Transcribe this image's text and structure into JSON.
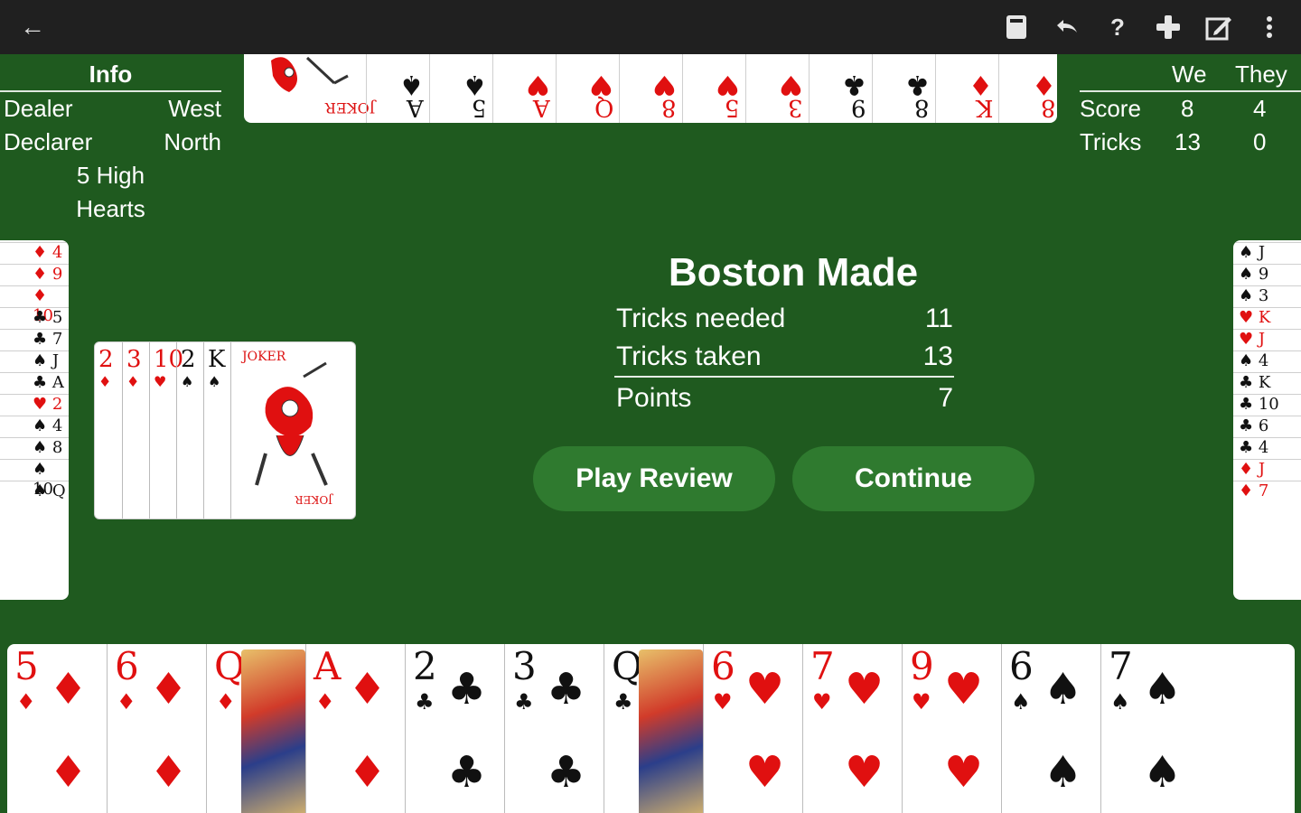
{
  "appbar": {
    "back_icon": "arrow-back-icon",
    "icons": [
      "cards-icon",
      "undo-icon",
      "help-icon",
      "new-game-icon",
      "edit-icon",
      "more-vert-icon"
    ]
  },
  "info": {
    "title": "Info",
    "rows": [
      {
        "label": "Dealer",
        "value": "West"
      },
      {
        "label": "Declarer",
        "value": "North"
      }
    ],
    "bid": "5 High",
    "trump": "Hearts"
  },
  "score": {
    "headers": {
      "we": "We",
      "they": "They"
    },
    "rows": [
      {
        "label": "Score",
        "we": "8",
        "they": "4"
      },
      {
        "label": "Tricks",
        "we": "13",
        "they": "0"
      }
    ]
  },
  "result": {
    "title": "Boston Made",
    "rows": [
      {
        "label": "Tricks needed",
        "value": "11"
      },
      {
        "label": "Tricks taken",
        "value": "13"
      },
      {
        "label": "Points",
        "value": "7"
      }
    ],
    "play_review": "Play Review",
    "continue": "Continue"
  },
  "north_hand": [
    {
      "rank": "A",
      "suit": "♠",
      "color": "black"
    },
    {
      "rank": "5",
      "suit": "♠",
      "color": "black"
    },
    {
      "rank": "A",
      "suit": "♥",
      "color": "red"
    },
    {
      "rank": "Q",
      "suit": "♥",
      "color": "red"
    },
    {
      "rank": "8",
      "suit": "♥",
      "color": "red"
    },
    {
      "rank": "5",
      "suit": "♥",
      "color": "red"
    },
    {
      "rank": "3",
      "suit": "♥",
      "color": "red"
    },
    {
      "rank": "9",
      "suit": "♣",
      "color": "black"
    },
    {
      "rank": "8",
      "suit": "♣",
      "color": "black"
    },
    {
      "rank": "K",
      "suit": "♦",
      "color": "red"
    },
    {
      "rank": "8",
      "suit": "♦",
      "color": "red"
    }
  ],
  "north_joker_text": "JOKER",
  "west_hand": [
    {
      "rank": "4",
      "suit": "♦",
      "color": "red"
    },
    {
      "rank": "9",
      "suit": "♦",
      "color": "red"
    },
    {
      "rank": "10",
      "suit": "♦",
      "color": "red"
    },
    {
      "rank": "5",
      "suit": "♣",
      "color": "black"
    },
    {
      "rank": "7",
      "suit": "♣",
      "color": "black"
    },
    {
      "rank": "J",
      "suit": "♠",
      "color": "black"
    },
    {
      "rank": "A",
      "suit": "♣",
      "color": "black"
    },
    {
      "rank": "2",
      "suit": "♥",
      "color": "red"
    },
    {
      "rank": "4",
      "suit": "♠",
      "color": "black"
    },
    {
      "rank": "8",
      "suit": "♠",
      "color": "black"
    },
    {
      "rank": "10",
      "suit": "♠",
      "color": "black"
    },
    {
      "rank": "Q",
      "suit": "♠",
      "color": "black"
    }
  ],
  "east_hand": [
    {
      "rank": "J",
      "suit": "♠",
      "color": "black"
    },
    {
      "rank": "9",
      "suit": "♠",
      "color": "black"
    },
    {
      "rank": "3",
      "suit": "♠",
      "color": "black"
    },
    {
      "rank": "K",
      "suit": "♥",
      "color": "red"
    },
    {
      "rank": "J",
      "suit": "♥",
      "color": "red"
    },
    {
      "rank": "4",
      "suit": "♠",
      "color": "black"
    },
    {
      "rank": "K",
      "suit": "♣",
      "color": "black"
    },
    {
      "rank": "10",
      "suit": "♣",
      "color": "black"
    },
    {
      "rank": "6",
      "suit": "♣",
      "color": "black"
    },
    {
      "rank": "4",
      "suit": "♣",
      "color": "black"
    },
    {
      "rank": "J",
      "suit": "♦",
      "color": "red"
    },
    {
      "rank": "7",
      "suit": "♦",
      "color": "red"
    }
  ],
  "kitty": [
    {
      "rank": "2",
      "suit": "♦",
      "color": "red"
    },
    {
      "rank": "3",
      "suit": "♦",
      "color": "red"
    },
    {
      "rank": "10",
      "suit": "♥",
      "color": "red"
    },
    {
      "rank": "2",
      "suit": "♠",
      "color": "black"
    },
    {
      "rank": "K",
      "suit": "♠",
      "color": "black"
    }
  ],
  "kitty_joker_text": "JOKER",
  "south_hand": [
    {
      "rank": "5",
      "suit": "♦",
      "color": "red"
    },
    {
      "rank": "6",
      "suit": "♦",
      "color": "red"
    },
    {
      "rank": "Q",
      "suit": "♦",
      "color": "red"
    },
    {
      "rank": "A",
      "suit": "♦",
      "color": "red"
    },
    {
      "rank": "2",
      "suit": "♣",
      "color": "black"
    },
    {
      "rank": "3",
      "suit": "♣",
      "color": "black"
    },
    {
      "rank": "Q",
      "suit": "♣",
      "color": "black"
    },
    {
      "rank": "6",
      "suit": "♥",
      "color": "red"
    },
    {
      "rank": "7",
      "suit": "♥",
      "color": "red"
    },
    {
      "rank": "9",
      "suit": "♥",
      "color": "red"
    },
    {
      "rank": "6",
      "suit": "♠",
      "color": "black"
    },
    {
      "rank": "7",
      "suit": "♠",
      "color": "black"
    }
  ],
  "colors": {
    "table": "#1f5a1f",
    "button": "#2f7a2f",
    "red_suit": "#e01010",
    "appbar": "#202020"
  }
}
